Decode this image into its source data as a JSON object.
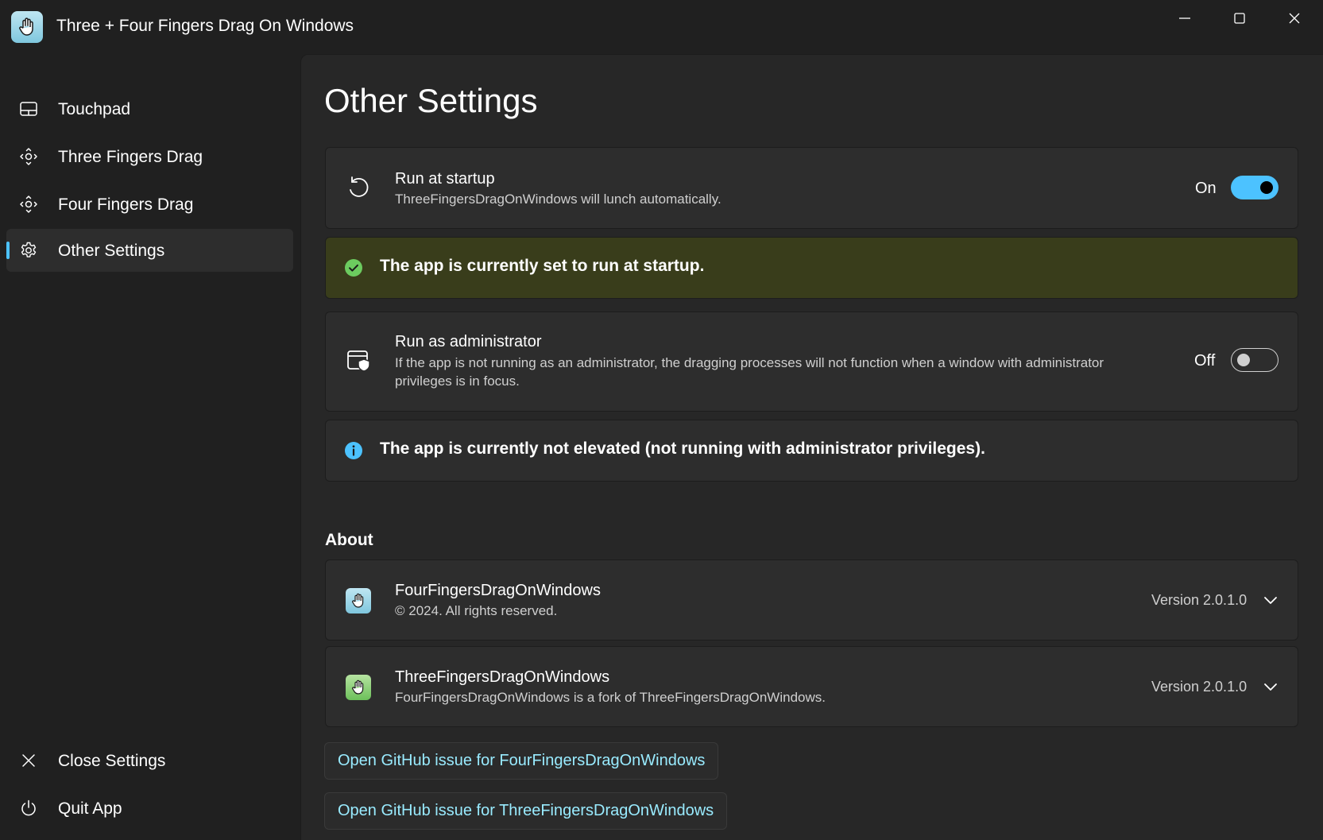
{
  "window": {
    "title": "Three + Four Fingers Drag On Windows"
  },
  "sidebar": {
    "items": [
      {
        "label": "Touchpad",
        "icon": "touchpad-icon",
        "active": false
      },
      {
        "label": "Three Fingers Drag",
        "icon": "drag-move-icon",
        "active": false
      },
      {
        "label": "Four Fingers Drag",
        "icon": "drag-move-icon",
        "active": false
      },
      {
        "label": "Other Settings",
        "icon": "gear-icon",
        "active": true
      }
    ],
    "footer": [
      {
        "label": "Close Settings",
        "icon": "close-icon"
      },
      {
        "label": "Quit App",
        "icon": "power-icon"
      }
    ]
  },
  "main": {
    "title": "Other Settings",
    "startup": {
      "title": "Run at startup",
      "description": "ThreeFingersDragOnWindows will lunch automatically.",
      "toggle_label": "On",
      "enabled": true
    },
    "startup_status": "The app is currently set to run at startup.",
    "admin": {
      "title": "Run as administrator",
      "description_line1": "If the app is not running as an administrator, the dragging processes will not function when a window with administrator",
      "description_line2": "privileges is in focus.",
      "toggle_label": "Off",
      "enabled": false
    },
    "admin_status": "The app is currently not elevated (not running with administrator privileges).",
    "about": {
      "heading": "About",
      "apps": [
        {
          "name": "FourFingersDragOnWindows",
          "subtitle": "© 2024. All rights reserved.",
          "version": "Version 2.0.1.0"
        },
        {
          "name": "ThreeFingersDragOnWindows",
          "subtitle": "FourFingersDragOnWindows is a fork of ThreeFingersDragOnWindows.",
          "version": "Version 2.0.1.0"
        }
      ]
    },
    "links": [
      "Open GitHub issue for FourFingersDragOnWindows",
      "Open GitHub issue for ThreeFingersDragOnWindows"
    ]
  },
  "colors": {
    "accent": "#4cc2ff",
    "success_bar": "#393d1b",
    "success_icon": "#6ccb5f",
    "info_icon": "#4cc2ff",
    "link": "#99ebff"
  }
}
